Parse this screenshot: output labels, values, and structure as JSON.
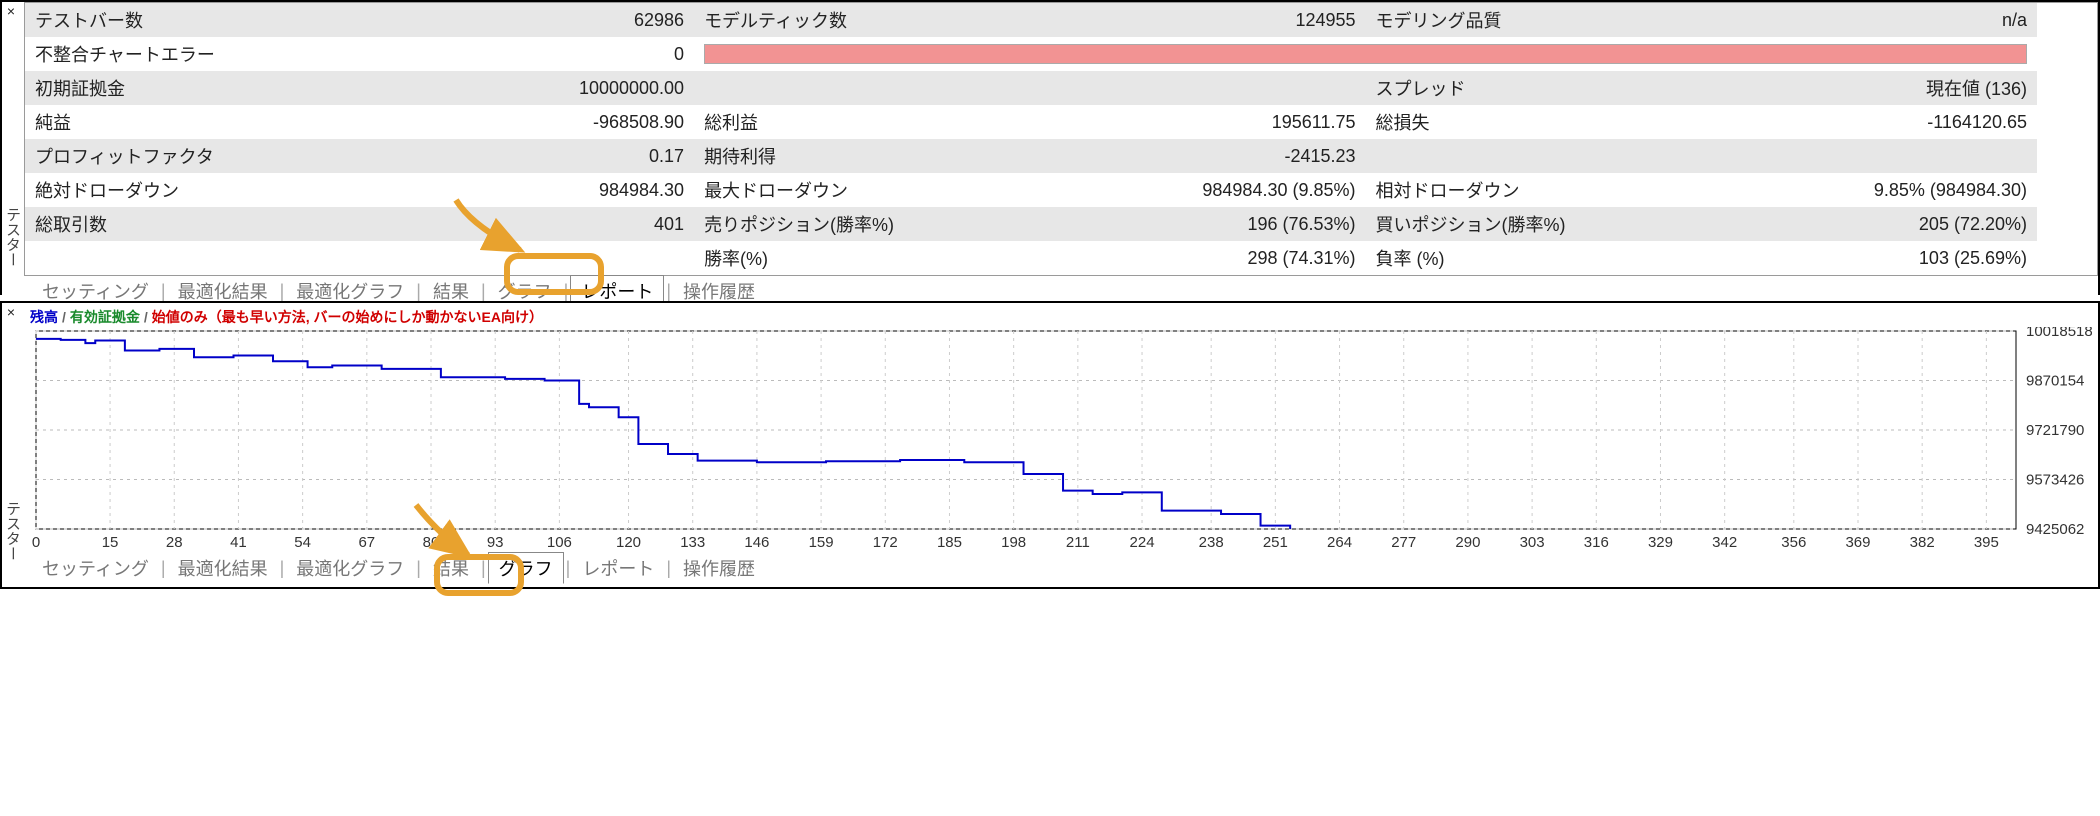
{
  "panelTitle": "テスター",
  "rows": [
    [
      {
        "lbl": "テストバー数",
        "val": "62986"
      },
      {
        "lbl": "モデルティック数",
        "val": "124955"
      },
      {
        "lbl": "モデリング品質",
        "val": "n/a"
      }
    ],
    [
      {
        "lbl": "不整合チャートエラー",
        "val": "0"
      },
      {
        "lbl": "",
        "val": "__REDBAR__",
        "colspan": 4
      }
    ],
    [
      {
        "lbl": "初期証拠金",
        "val": "10000000.00"
      },
      {
        "lbl": "",
        "val": ""
      },
      {
        "lbl": "スプレッド",
        "val": "現在値 (136)"
      }
    ],
    [
      {
        "lbl": "純益",
        "val": "-968508.90"
      },
      {
        "lbl": "総利益",
        "val": "195611.75"
      },
      {
        "lbl": "総損失",
        "val": "-1164120.65"
      }
    ],
    [
      {
        "lbl": "プロフィットファクタ",
        "val": "0.17"
      },
      {
        "lbl": "期待利得",
        "val": "-2415.23"
      },
      {
        "lbl": "",
        "val": ""
      }
    ],
    [
      {
        "lbl": "絶対ドローダウン",
        "val": "984984.30"
      },
      {
        "lbl": "最大ドローダウン",
        "val": "984984.30 (9.85%)"
      },
      {
        "lbl": "相対ドローダウン",
        "val": "9.85% (984984.30)"
      }
    ],
    [
      {
        "lbl": "総取引数",
        "val": "401"
      },
      {
        "lbl": "売りポジション(勝率%)",
        "val": "196 (76.53%)"
      },
      {
        "lbl": "買いポジション(勝率%)",
        "val": "205 (72.20%)"
      }
    ],
    [
      {
        "lbl": "",
        "val": ""
      },
      {
        "lbl": "勝率(%)",
        "val": "298 (74.31%)"
      },
      {
        "lbl": "負率 (%)",
        "val": "103 (25.69%)"
      }
    ]
  ],
  "tabs1": [
    "セッティング",
    "最適化結果",
    "最適化グラフ",
    "結果",
    "グラフ",
    "レポート",
    "操作履歴"
  ],
  "tabs1_active": 5,
  "tabs2": [
    "セッティング",
    "最適化結果",
    "最適化グラフ",
    "結果",
    "グラフ",
    "レポート",
    "操作履歴"
  ],
  "tabs2_active": 4,
  "legend": {
    "balance": "残高",
    "equity": "有効証拠金",
    "openOnly": "始値のみ（最も早い方法, バーの始めにしか動かないEA向け）"
  },
  "chart_data": {
    "type": "line",
    "title": "",
    "xlabel": "",
    "ylabel": "",
    "ylim": [
      9425062,
      10018518
    ],
    "x_ticks": [
      0,
      15,
      28,
      41,
      54,
      67,
      80,
      93,
      106,
      120,
      133,
      146,
      159,
      172,
      185,
      198,
      211,
      224,
      238,
      251,
      264,
      277,
      290,
      303,
      316,
      329,
      342,
      356,
      369,
      382,
      395
    ],
    "y_ticks": [
      10018518,
      9870154,
      9721790,
      9573426,
      9425062
    ],
    "series": [
      {
        "name": "残高",
        "color": "#0000c8",
        "points": [
          {
            "x": 0,
            "y": 9995000
          },
          {
            "x": 5,
            "y": 9992000
          },
          {
            "x": 10,
            "y": 9982000
          },
          {
            "x": 12,
            "y": 9990000
          },
          {
            "x": 18,
            "y": 9960000
          },
          {
            "x": 25,
            "y": 9965000
          },
          {
            "x": 32,
            "y": 9940000
          },
          {
            "x": 40,
            "y": 9945000
          },
          {
            "x": 48,
            "y": 9928000
          },
          {
            "x": 55,
            "y": 9910000
          },
          {
            "x": 60,
            "y": 9915000
          },
          {
            "x": 70,
            "y": 9905000
          },
          {
            "x": 82,
            "y": 9880000
          },
          {
            "x": 95,
            "y": 9875000
          },
          {
            "x": 103,
            "y": 9870000
          },
          {
            "x": 110,
            "y": 9800000
          },
          {
            "x": 112,
            "y": 9790000
          },
          {
            "x": 118,
            "y": 9760000
          },
          {
            "x": 122,
            "y": 9680000
          },
          {
            "x": 128,
            "y": 9650000
          },
          {
            "x": 134,
            "y": 9630000
          },
          {
            "x": 146,
            "y": 9625000
          },
          {
            "x": 160,
            "y": 9628000
          },
          {
            "x": 175,
            "y": 9632000
          },
          {
            "x": 188,
            "y": 9625000
          },
          {
            "x": 200,
            "y": 9590000
          },
          {
            "x": 208,
            "y": 9540000
          },
          {
            "x": 214,
            "y": 9530000
          },
          {
            "x": 220,
            "y": 9535000
          },
          {
            "x": 228,
            "y": 9480000
          },
          {
            "x": 240,
            "y": 9470000
          },
          {
            "x": 248,
            "y": 9435000
          },
          {
            "x": 254,
            "y": 9425062
          }
        ]
      }
    ],
    "x_range": [
      0,
      401
    ]
  }
}
